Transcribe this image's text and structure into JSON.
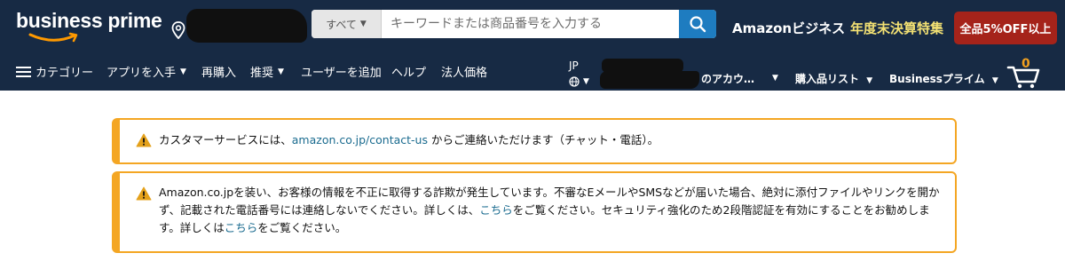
{
  "header": {
    "logo": {
      "word1": "business",
      "word2": "prime"
    },
    "search": {
      "category": "すべて",
      "placeholder": "キーワードまたは商品番号を入力する"
    },
    "promo": {
      "business": "Amazonビジネス",
      "year_end": "年度末決算特集",
      "badge": "全品5%OFF以上"
    },
    "nav": {
      "items": [
        "カテゴリー",
        "アプリを入手",
        "再購入",
        "推奨",
        "ユーザーを追加",
        "ヘルプ",
        "法人価格"
      ]
    },
    "lang": "JP",
    "account": "のアカウ…",
    "purchase_list": "購入品リスト",
    "business_prime": "Businessプライム",
    "cart_count": "0"
  },
  "alerts": [
    {
      "before": "カスタマーサービスには、",
      "link": "amazon.co.jp/contact-us",
      "after": " からご連絡いただけます（チャット・電話）。"
    },
    {
      "part1": "Amazon.co.jpを装い、お客様の情報を不正に取得する詐欺が発生しています。不審なEメールやSMSなどが届いた場合、絶対に添付ファイルやリンクを開かず、記載された電話番号には連絡しないでください。詳しくは、",
      "link1": "こちら",
      "part2": "をご覧ください。セキュリティ強化のため2段階認証を有効にすることをお勧めします。詳しくは",
      "link2": "こちら",
      "part3": "をご覧ください。"
    }
  ],
  "colors": {
    "header_bg": "#172a44",
    "alert_border": "#f4a623",
    "link": "#1a6b8f",
    "promo_badge": "#a5231a",
    "search_button": "#1e7cc0"
  }
}
